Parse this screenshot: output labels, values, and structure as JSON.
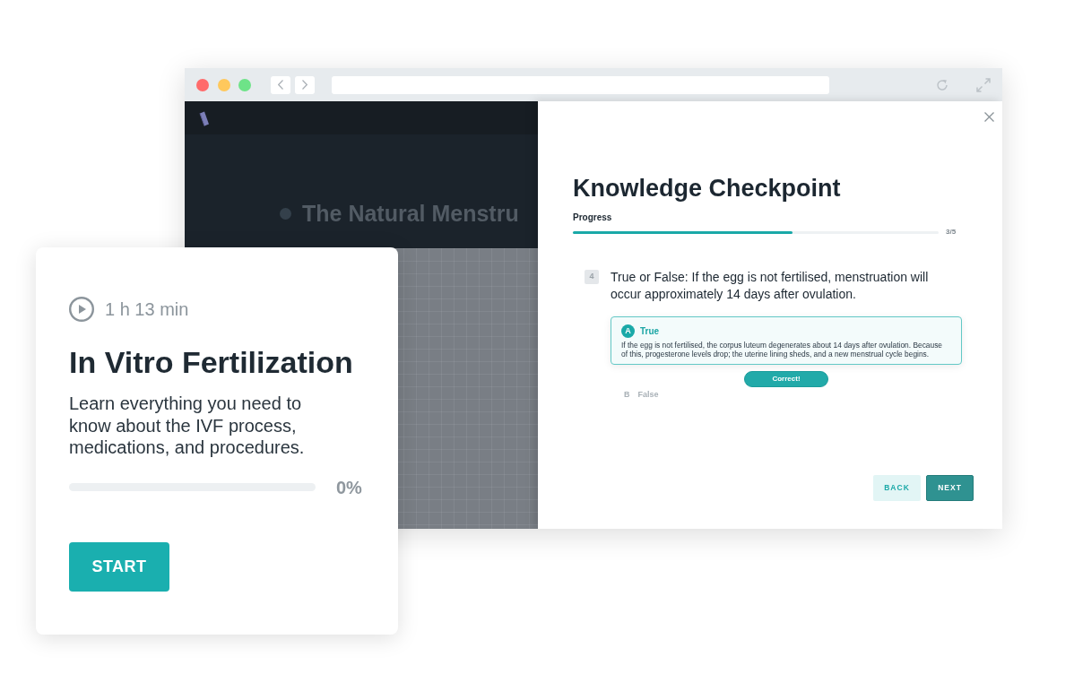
{
  "background_page": {
    "heading": "The Natural Menstru"
  },
  "checkpoint": {
    "title": "Knowledge Checkpoint",
    "progress_label": "Progress",
    "progress": {
      "level": 0.6,
      "reading": "3/5"
    },
    "question": {
      "number": "4",
      "text": "True or False: If the egg is not fertilised, menstruation will occur approximately 14 days after ovulation."
    },
    "options": [
      {
        "letter": "A",
        "label": "True",
        "selected": true,
        "explanation": "If the egg is not fertilised, the corpus luteum degenerates about 14 days after ovulation. Because of this, progesterone levels drop; the uterine lining sheds, and a new menstrual cycle begins.",
        "feedback": "Correct!"
      },
      {
        "letter": "B",
        "label": "False",
        "selected": false
      }
    ],
    "buttons": [
      {
        "label": "BACK",
        "kind": "secondary"
      },
      {
        "label": "NEXT",
        "kind": "primary"
      }
    ]
  },
  "course_card": {
    "duration": "1 h 13 min",
    "title": "In Vitro Fertilization",
    "description": "Learn everything you need to know about the IVF process, medications, and procedures.",
    "progress": {
      "level": 0,
      "reading": "0%"
    },
    "button": "START"
  }
}
